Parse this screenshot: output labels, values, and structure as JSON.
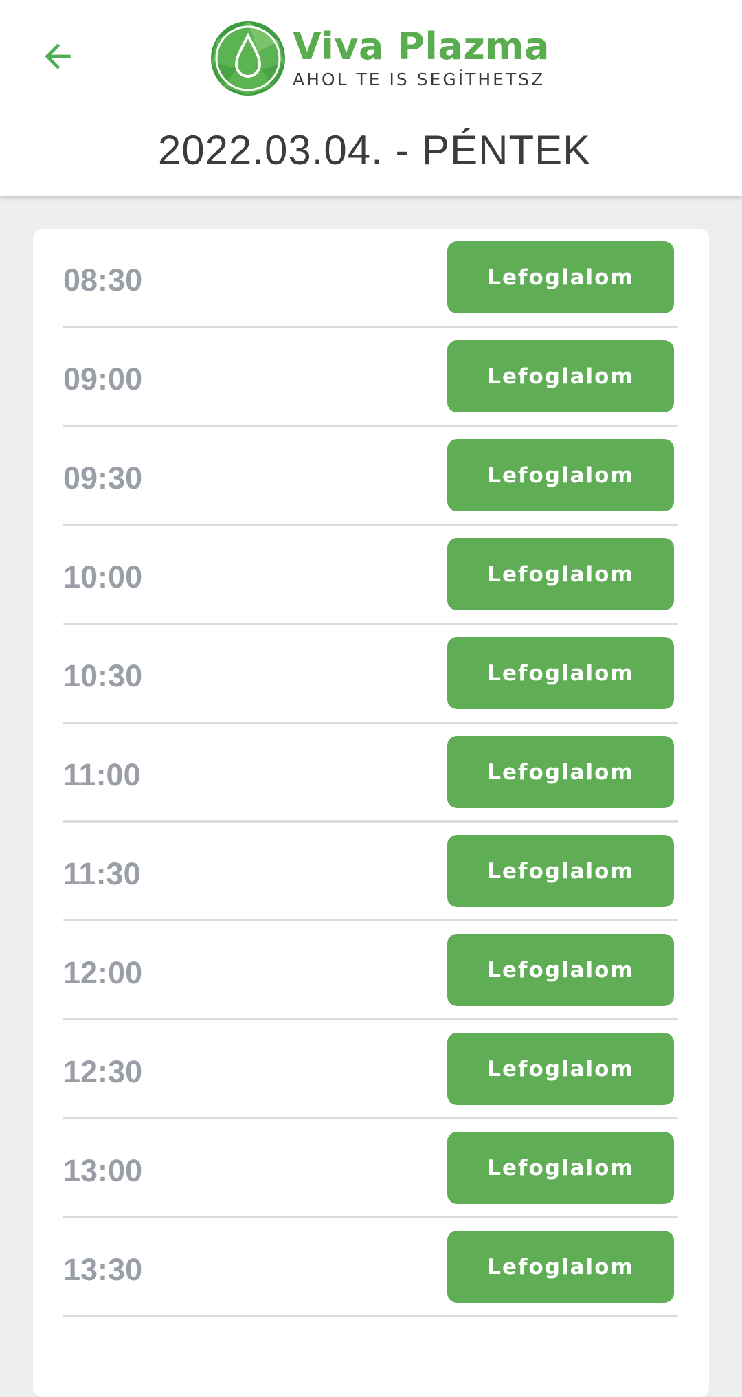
{
  "header": {
    "back_icon": "arrow-left-icon",
    "logo": {
      "name": "Viva Plazma",
      "tagline": "AHOL TE IS SEGÍTHETSZ",
      "icon": "blood-drop-icon"
    },
    "date_title": "2022.03.04. - PÉNTEK"
  },
  "colors": {
    "brand_green": "#5aad4e",
    "button_green": "#5fae56",
    "time_gray": "#9a9ea6",
    "background": "#eeeeee"
  },
  "slots": [
    {
      "time": "08:30",
      "button_label": "Lefoglalom"
    },
    {
      "time": "09:00",
      "button_label": "Lefoglalom"
    },
    {
      "time": "09:30",
      "button_label": "Lefoglalom"
    },
    {
      "time": "10:00",
      "button_label": "Lefoglalom"
    },
    {
      "time": "10:30",
      "button_label": "Lefoglalom"
    },
    {
      "time": "11:00",
      "button_label": "Lefoglalom"
    },
    {
      "time": "11:30",
      "button_label": "Lefoglalom"
    },
    {
      "time": "12:00",
      "button_label": "Lefoglalom"
    },
    {
      "time": "12:30",
      "button_label": "Lefoglalom"
    },
    {
      "time": "13:00",
      "button_label": "Lefoglalom"
    },
    {
      "time": "13:30",
      "button_label": "Lefoglalom"
    }
  ]
}
